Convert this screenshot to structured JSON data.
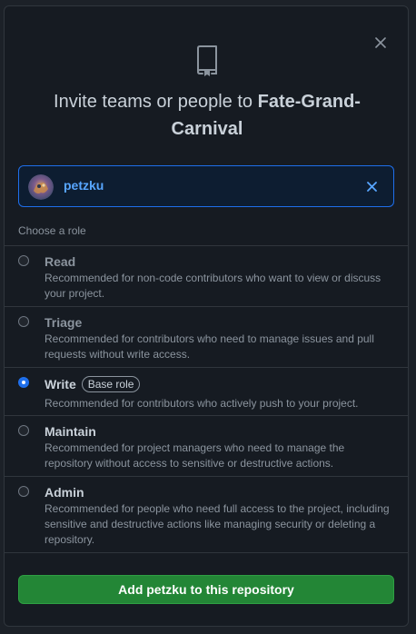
{
  "modal": {
    "title_prefix": "Invite teams or people to ",
    "repo_name": "Fate-Grand-Carnival",
    "close_icon": "close-icon",
    "repo_icon": "repo-icon"
  },
  "selected_user": {
    "username": "petzku",
    "avatar_icon": "avatar",
    "remove_icon": "close-icon"
  },
  "roles_heading": "Choose a role",
  "roles": [
    {
      "label": "Read",
      "description": "Recommended for non-code contributors who want to view or discuss your project.",
      "checked": false
    },
    {
      "label": "Triage",
      "description": "Recommended for contributors who need to manage issues and pull requests without write access.",
      "checked": false
    },
    {
      "label": "Write",
      "badge": "Base role",
      "description": "Recommended for contributors who actively push to your project.",
      "checked": true
    },
    {
      "label": "Maintain",
      "description": "Recommended for project managers who need to manage the repository without access to sensitive or destructive actions.",
      "checked": false
    },
    {
      "label": "Admin",
      "description": "Recommended for people who need full access to the project, including sensitive and destructive actions like managing security or deleting a repository.",
      "checked": false
    }
  ],
  "submit_label": "Add petzku to this repository",
  "colors": {
    "accent": "#1f6feb",
    "link": "#58a6ff",
    "primary_button": "#238636",
    "background": "#161b22"
  }
}
